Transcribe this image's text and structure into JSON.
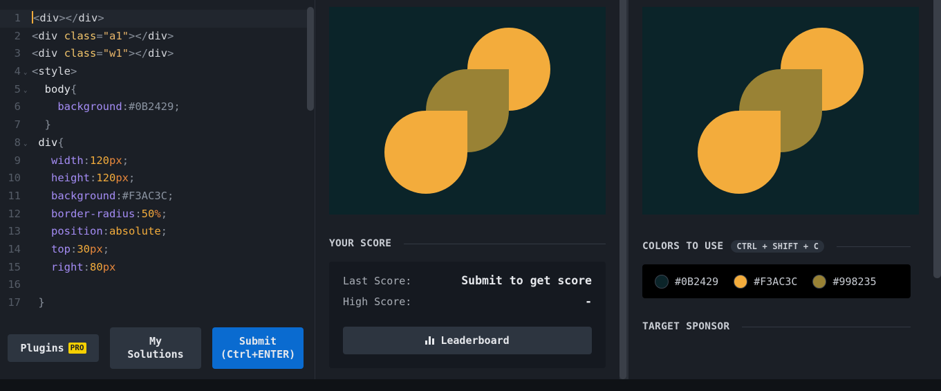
{
  "editor": {
    "lines": [
      {
        "n": "1",
        "html": "<span class='cursor'></span><span class='tok-punc'>&lt;</span><span class='tok-tag'>div</span><span class='tok-punc'>&gt;&lt;/</span><span class='tok-tag'>div</span><span class='tok-punc'>&gt;</span>",
        "active": true
      },
      {
        "n": "2",
        "html": "<span class='tok-punc'>&lt;</span><span class='tok-tag'>div</span> <span class='tok-attr'>class</span><span class='tok-punc'>=</span><span class='tok-str'>\"a1\"</span><span class='tok-punc'>&gt;&lt;/</span><span class='tok-tag'>div</span><span class='tok-punc'>&gt;</span>"
      },
      {
        "n": "3",
        "html": "<span class='tok-punc'>&lt;</span><span class='tok-tag'>div</span> <span class='tok-attr'>class</span><span class='tok-punc'>=</span><span class='tok-str'>\"w1\"</span><span class='tok-punc'>&gt;&lt;/</span><span class='tok-tag'>div</span><span class='tok-punc'>&gt;</span>"
      },
      {
        "n": "4",
        "fold": true,
        "html": "<span class='tok-punc'>&lt;</span><span class='tok-tag'>style</span><span class='tok-punc'>&gt;</span>"
      },
      {
        "n": "5",
        "fold": true,
        "html": "  <span class='tok-sel'>body</span><span class='tok-punc'>{</span>"
      },
      {
        "n": "6",
        "html": "    <span class='tok-prop'>background</span><span class='tok-punc'>:</span><span class='tok-hex'>#0B2429</span><span class='tok-punc'>;</span>"
      },
      {
        "n": "7",
        "html": "  <span class='tok-punc'>}</span>"
      },
      {
        "n": "8",
        "fold": true,
        "html": " <span class='tok-sel'>div</span><span class='tok-punc'>{</span>"
      },
      {
        "n": "9",
        "html": "   <span class='tok-prop'>width</span><span class='tok-punc'>:</span><span class='tok-num'>120</span><span class='tok-unit'>px</span><span class='tok-punc'>;</span>"
      },
      {
        "n": "10",
        "html": "   <span class='tok-prop'>height</span><span class='tok-punc'>:</span><span class='tok-num'>120</span><span class='tok-unit'>px</span><span class='tok-punc'>;</span>"
      },
      {
        "n": "11",
        "html": "   <span class='tok-prop'>background</span><span class='tok-punc'>:</span><span class='tok-hex'>#F3AC3C</span><span class='tok-punc'>;</span>"
      },
      {
        "n": "12",
        "html": "   <span class='tok-prop'>border-radius</span><span class='tok-punc'>:</span><span class='tok-num'>50</span><span class='tok-unit'>%</span><span class='tok-punc'>;</span>"
      },
      {
        "n": "13",
        "html": "   <span class='tok-prop'>position</span><span class='tok-punc'>:</span><span class='tok-val'>absolute</span><span class='tok-punc'>;</span>"
      },
      {
        "n": "14",
        "html": "   <span class='tok-prop'>top</span><span class='tok-punc'>:</span><span class='tok-num'>30</span><span class='tok-unit'>px</span><span class='tok-punc'>;</span>"
      },
      {
        "n": "15",
        "html": "   <span class='tok-prop'>right</span><span class='tok-punc'>:</span><span class='tok-num'>80</span><span class='tok-unit'>px</span>"
      },
      {
        "n": "16",
        "html": ""
      },
      {
        "n": "17",
        "html": " <span class='tok-punc'>}</span>"
      }
    ],
    "plugins_label": "Plugins",
    "pro_badge": "PRO",
    "solutions_label": "My Solutions",
    "submit_label": "Submit (Ctrl+ENTER)"
  },
  "score": {
    "title": "YOUR SCORE",
    "last_label": "Last Score:",
    "last_value": "Submit to get score",
    "high_label": "High Score:",
    "high_value": "-",
    "leaderboard_label": "Leaderboard"
  },
  "target": {
    "colors_title": "COLORS TO USE",
    "shortcut": "CTRL + SHIFT + C",
    "colors": [
      {
        "hex": "#0B2429",
        "label": "#0B2429"
      },
      {
        "hex": "#F3AC3C",
        "label": "#F3AC3C"
      },
      {
        "hex": "#998235",
        "label": "#998235"
      }
    ],
    "sponsor_title": "TARGET SPONSOR"
  },
  "palette": {
    "background": "#0B2429",
    "primary": "#F3AC3C",
    "secondary": "#998235",
    "accent_button": "#0A6BD0"
  }
}
